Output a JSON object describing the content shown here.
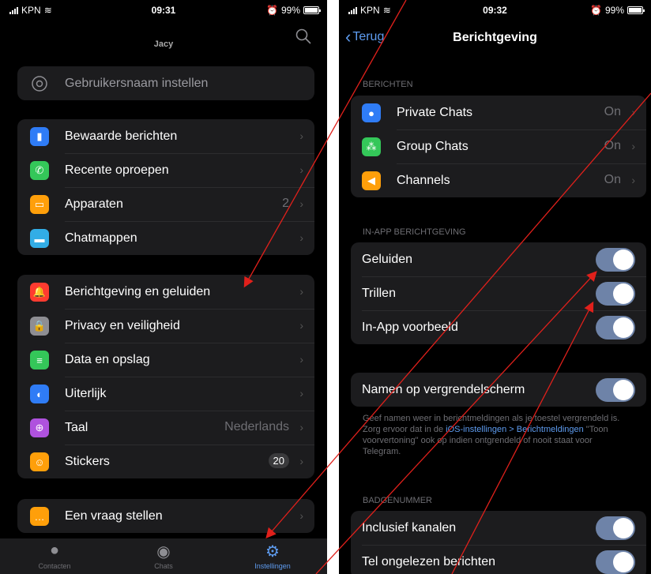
{
  "left": {
    "status": {
      "carrier": "KPN",
      "time": "09:31",
      "battery": "99%"
    },
    "nav_title": "Jacy",
    "username_row": "Gebruikersnaam instellen",
    "group1": [
      {
        "label": "Bewaarde berichten",
        "icon": "bookmark-icon",
        "color": "#2f7cf6"
      },
      {
        "label": "Recente oproepen",
        "icon": "phone-icon",
        "color": "#34c759"
      },
      {
        "label": "Apparaten",
        "icon": "laptop-icon",
        "color": "#ff9f0a",
        "detail": "2"
      },
      {
        "label": "Chatmappen",
        "icon": "folder-icon",
        "color": "#32ade6"
      }
    ],
    "group2": [
      {
        "label": "Berichtgeving en geluiden",
        "icon": "bell-icon",
        "color": "#ff3b30"
      },
      {
        "label": "Privacy en veiligheid",
        "icon": "lock-icon",
        "color": "#8e8e93"
      },
      {
        "label": "Data en opslag",
        "icon": "database-icon",
        "color": "#34c759"
      },
      {
        "label": "Uiterlijk",
        "icon": "appearance-icon",
        "color": "#2f7cf6"
      },
      {
        "label": "Taal",
        "icon": "globe-icon",
        "color": "#af52de",
        "detail": "Nederlands"
      },
      {
        "label": "Stickers",
        "icon": "sticker-icon",
        "color": "#ff9f0a",
        "badge": "20"
      }
    ],
    "group3": [
      {
        "label": "Een vraag stellen",
        "icon": "chat-bubble-icon",
        "color": "#ff9f0a"
      }
    ],
    "tabs": [
      {
        "label": "Contacten",
        "icon": "person-icon"
      },
      {
        "label": "Chats",
        "icon": "chats-icon"
      },
      {
        "label": "Instellingen",
        "icon": "gear-icon",
        "active": true
      }
    ]
  },
  "right": {
    "status": {
      "carrier": "KPN",
      "time": "09:32",
      "battery": "99%"
    },
    "back_label": "Terug",
    "title": "Berichtgeving",
    "section_berichten": "BERICHTEN",
    "berichten": [
      {
        "label": "Private Chats",
        "value": "On",
        "icon": "person-icon",
        "color": "#2f7cf6"
      },
      {
        "label": "Group Chats",
        "value": "On",
        "icon": "group-icon",
        "color": "#34c759"
      },
      {
        "label": "Channels",
        "value": "On",
        "icon": "megaphone-icon",
        "color": "#ff9f0a"
      }
    ],
    "section_inapp": "IN-APP BERICHTGEVING",
    "inapp": [
      {
        "label": "Geluiden",
        "on": true
      },
      {
        "label": "Trillen",
        "on": true
      },
      {
        "label": "In-App voorbeeld",
        "on": true
      }
    ],
    "lockscreen": {
      "label": "Namen op vergrendelscherm",
      "on": true
    },
    "footnote": {
      "part1": "Geef namen weer in berichtmeldingen als je toestel vergrendeld is. Zorg ervoor dat in de ",
      "link1": "iOS-instellingen > Berichtmeldingen",
      "part2": " \"Toon voorvertoning\" ook op indien ontgrendeld of nooit staat voor Telegram."
    },
    "section_badge": "BADGENUMMER",
    "badge": [
      {
        "label": "Inclusief kanalen",
        "on": true
      },
      {
        "label": "Tel ongelezen berichten",
        "on": true
      }
    ]
  },
  "colors": {
    "accent": "#5e9cf0",
    "annotation": "#e0201b"
  }
}
